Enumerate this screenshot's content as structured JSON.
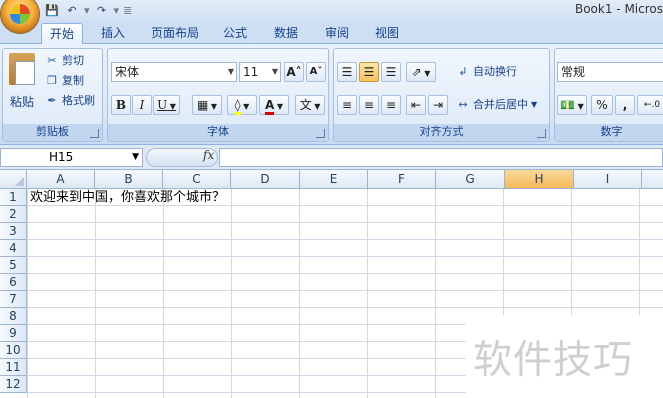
{
  "title": "Book1 - Micros",
  "qat": {
    "save_icon": "save-icon",
    "undo_icon": "undo-icon",
    "redo_icon": "redo-icon",
    "more": "≣"
  },
  "tabs": [
    "开始",
    "插入",
    "页面布局",
    "公式",
    "数据",
    "审阅",
    "视图"
  ],
  "clipboard": {
    "paste": "粘贴",
    "cut": "剪切",
    "copy": "复制",
    "format_painter": "格式刷",
    "label": "剪贴板"
  },
  "font": {
    "name": "宋体",
    "size": "11",
    "grow": "A˄",
    "shrink": "A˅",
    "bold": "B",
    "italic": "I",
    "underline": "U",
    "font_color": "A",
    "phonetic": "文",
    "label": "字体"
  },
  "alignment": {
    "wrap_text": "自动换行",
    "merge_center": "合并后居中",
    "label": "对齐方式"
  },
  "number": {
    "format": "常规",
    "percent": "%",
    "comma": ",",
    "label": "数字"
  },
  "formula_bar": {
    "cell_ref": "H15",
    "fx": "fx"
  },
  "columns": [
    "A",
    "B",
    "C",
    "D",
    "E",
    "F",
    "G",
    "H",
    "I"
  ],
  "selected_column": "H",
  "rows": [
    "1",
    "2",
    "3",
    "4",
    "5",
    "6",
    "7",
    "8",
    "9",
    "10",
    "11",
    "12"
  ],
  "cell_a1": "欢迎来到中国，你喜欢那个城市？",
  "watermark": "软件技巧",
  "colors": {
    "accent": "#f5b85a",
    "tab_text": "#15428b",
    "grid": "#d0d7e5"
  }
}
